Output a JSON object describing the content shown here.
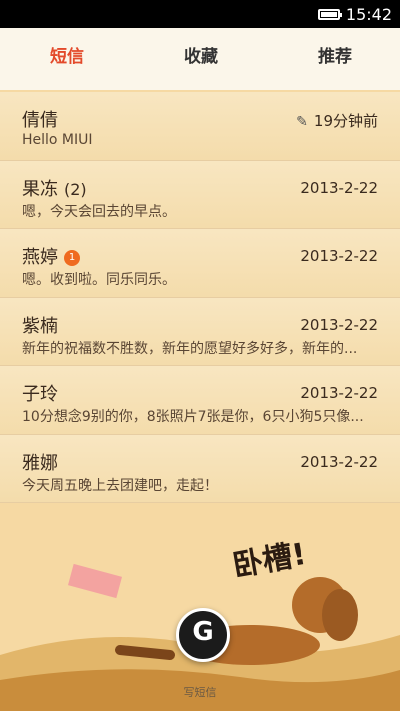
{
  "status": {
    "time": "15:42"
  },
  "tabs": [
    {
      "label": "短信"
    },
    {
      "label": "收藏"
    },
    {
      "label": "推荐"
    }
  ],
  "threads": [
    {
      "name": "倩倩",
      "count": "",
      "badge": "",
      "date": "19分钟前",
      "snippet": "Hello MIUI"
    },
    {
      "name": "果冻",
      "count": "(2)",
      "badge": "",
      "date": "2013-2-22",
      "snippet": "嗯，今天会回去的早点。"
    },
    {
      "name": "燕婷",
      "count": "",
      "badge": "1",
      "date": "2013-2-22",
      "snippet": "嗯。收到啦。同乐同乐。"
    },
    {
      "name": "紫楠",
      "count": "",
      "badge": "",
      "date": "2013-2-22",
      "snippet": "新年的祝福数不胜数，新年的愿望好多好多，新年的..."
    },
    {
      "name": "子玲",
      "count": "",
      "badge": "",
      "date": "2013-2-22",
      "snippet": "10分想念9别的你，8张照片7张是你，6只小狗5只像..."
    },
    {
      "name": "雅娜",
      "count": "",
      "badge": "",
      "date": "2013-2-22",
      "snippet": "今天周五晚上去团建吧，走起！"
    }
  ],
  "scene": {
    "banner": "卧槽!"
  },
  "compose": {
    "label": "写短信"
  }
}
